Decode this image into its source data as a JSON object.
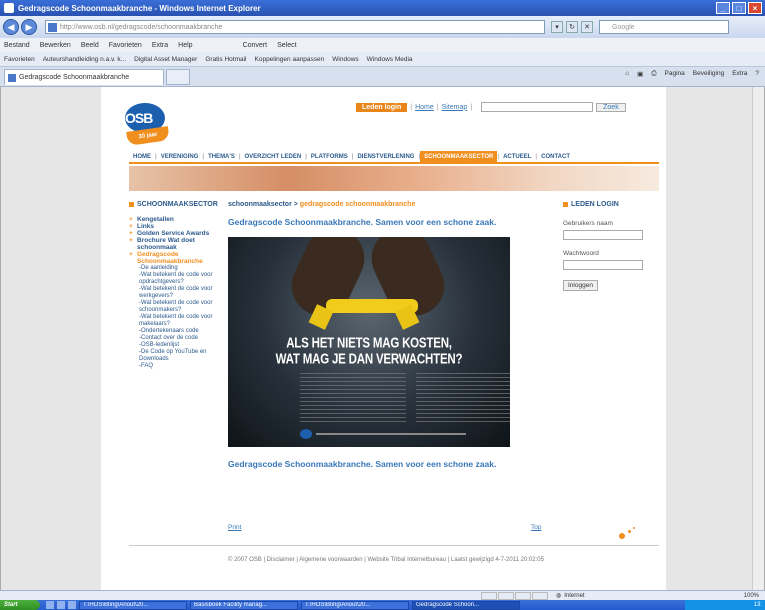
{
  "window": {
    "title": "Gedragscode Schoonmaakbranche - Windows Internet Explorer",
    "address": "http://www.osb.nl/gedragscode/schoonmaakbranche",
    "search_placeholder": "Google"
  },
  "menubar": [
    "Bestand",
    "Bewerken",
    "Beeld",
    "Favorieten",
    "Extra",
    "Help"
  ],
  "menubar_tools": [
    "Convert",
    "Select"
  ],
  "favorites_bar": [
    "Favorieten",
    "Auteurshandleiding n.a.v. k...",
    "Digital Asset Manager",
    "Gratis Hotmail",
    "Koppelingen aanpassen",
    "Windows",
    "Windows Media"
  ],
  "tab": {
    "label": "Gedragscode Schoonmaakbranche"
  },
  "command_bar": [
    "Pagina",
    "Beveiliging",
    "Extra"
  ],
  "site": {
    "logo_text": "OSB",
    "logo_banner": "30 jaar",
    "login_button": "Leden login",
    "links": [
      "Home",
      "Sitemap"
    ],
    "search_button": "Zoek",
    "nav": [
      "HOME",
      "VERENIGING",
      "THEMA'S",
      "OVERZICHT LEDEN",
      "PLATFORMS",
      "DIENSTVERLENING",
      "SCHOONMAAKSECTOR",
      "ACTUEEL",
      "CONTACT"
    ],
    "nav_active": "SCHOONMAAKSECTOR"
  },
  "left": {
    "heading": "SCHOONMAAKSECTOR",
    "items": [
      "Kengetallen",
      "Links",
      "Golden Service Awards",
      "Brochure Wat doet schoonmaak"
    ],
    "active_item": "Gedragscode Schoonmaakbranche",
    "subitems": [
      "-De aanleiding",
      "-Wat betekent de code voor opdrachtgevers?",
      "-Wat betekent de code voor werkgevers?",
      "-Wat betekent de code voor schoonmakers?",
      "-Wat betekent de code voor makelaars?",
      "-Ondertekenaars code",
      "-Contact over de code",
      "-OSB-ledenlijst",
      "-De Code op YouTube en Downloads",
      "-FAQ"
    ]
  },
  "main": {
    "breadcrumb_parent": "schoonmaaksector",
    "breadcrumb_sep": " > ",
    "breadcrumb_current": "gedragscode schoonmaakbranche",
    "title": "Gedragscode Schoonmaakbranche. Samen voor een schone zaak.",
    "poster_headline_1": "ALS HET NIETS MAG KOSTEN,",
    "poster_headline_2": "WAT MAG JE DAN VERWACHTEN?",
    "title_bottom": "Gedragscode Schoonmaakbranche. Samen voor een schone zaak.",
    "print": "Print",
    "top": "Top"
  },
  "right": {
    "heading": "LEDEN LOGIN",
    "user_label": "Gebruikers naam",
    "password_label": "Wachtwoord",
    "login_button": "Inloggen"
  },
  "footer": "© 2007 OSB | Disclaimer | Algemene voorwaarden | Website Tribal Internetbureau | Laatst gewijzigd 4-7-2011 20:02:05",
  "statusbar": {
    "zone": "Internet",
    "zoom": "100%"
  },
  "taskbar": {
    "start": "Start",
    "tasks": [
      "T:\\HOS\\Bting\\Anout\\20...",
      "Basisboek Facility manag...",
      "T:\\HOS\\Bting\\Anout\\20...",
      "Gedragscode Schoon..."
    ],
    "clock": "13:"
  },
  "colors": {
    "accent": "#f08e1e",
    "link": "#3a78b8",
    "nav": "#2c5a8c"
  }
}
